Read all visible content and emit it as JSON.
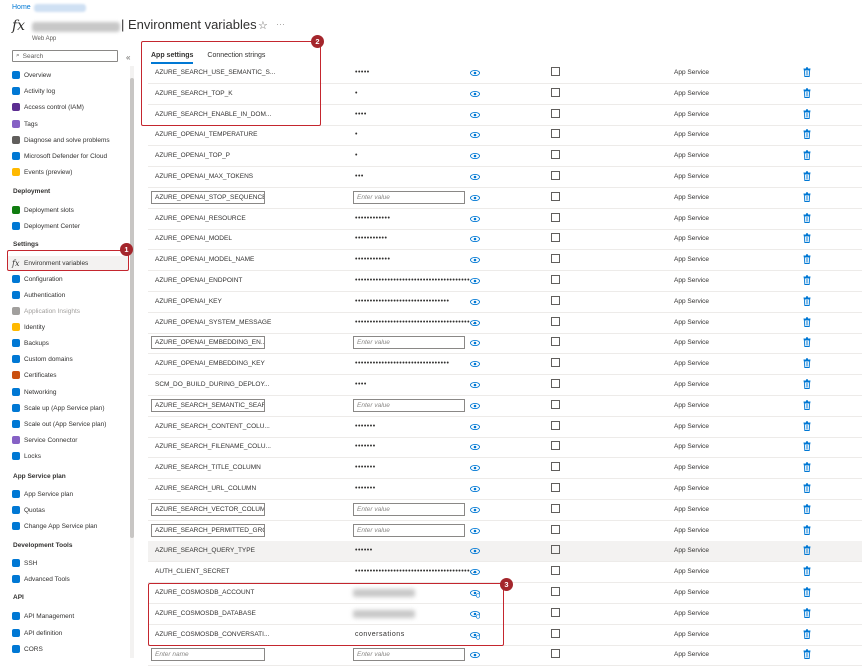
{
  "header": {
    "breadcrumb": "Home",
    "resource_type": "Web App",
    "title": "| Environment variables",
    "fx_glyph": "fx",
    "star": "☆",
    "more": "···"
  },
  "sidebar": {
    "search_placeholder": "Search",
    "collapse": "«",
    "items": [
      {
        "label": "Overview",
        "icon": "globe-icon",
        "color": "#0078d4"
      },
      {
        "label": "Activity log",
        "icon": "log-icon",
        "color": "#0078d4"
      },
      {
        "label": "Access control (IAM)",
        "icon": "people-icon",
        "color": "#5c2d91"
      },
      {
        "label": "Tags",
        "icon": "tag-icon",
        "color": "#8661c5"
      },
      {
        "label": "Diagnose and solve problems",
        "icon": "wrench-icon",
        "color": "#605e5c"
      },
      {
        "label": "Microsoft Defender for Cloud",
        "icon": "shield-icon",
        "color": "#0078d4"
      },
      {
        "label": "Events (preview)",
        "icon": "bolt-icon",
        "color": "#ffb900"
      }
    ],
    "sections": [
      {
        "title": "Deployment",
        "items": [
          {
            "label": "Deployment slots",
            "icon": "slots-icon",
            "color": "#107c10"
          },
          {
            "label": "Deployment Center",
            "icon": "cube-icon",
            "color": "#0078d4"
          }
        ]
      },
      {
        "title": "Settings",
        "items": [
          {
            "label": "Environment variables",
            "icon": "fx-icon",
            "color": "#323130"
          },
          {
            "label": "Configuration",
            "icon": "sliders-icon",
            "color": "#0078d4"
          },
          {
            "label": "Authentication",
            "icon": "person-key-icon",
            "color": "#0078d4"
          },
          {
            "label": "Application Insights",
            "icon": "lightbulb-icon",
            "color": "#a19f9d"
          },
          {
            "label": "Identity",
            "icon": "key-icon",
            "color": "#ffb900"
          },
          {
            "label": "Backups",
            "icon": "cloud-icon",
            "color": "#0078d4"
          },
          {
            "label": "Custom domains",
            "icon": "domain-icon",
            "color": "#0078d4"
          },
          {
            "label": "Certificates",
            "icon": "certificate-icon",
            "color": "#ca5010"
          },
          {
            "label": "Networking",
            "icon": "network-icon",
            "color": "#0078d4"
          },
          {
            "label": "Scale up (App Service plan)",
            "icon": "scale-up-icon",
            "color": "#0078d4"
          },
          {
            "label": "Scale out (App Service plan)",
            "icon": "scale-out-icon",
            "color": "#0078d4"
          },
          {
            "label": "Service Connector",
            "icon": "connector-icon",
            "color": "#8661c5"
          },
          {
            "label": "Locks",
            "icon": "lock-icon",
            "color": "#0078d4"
          }
        ]
      },
      {
        "title": "App Service plan",
        "items": [
          {
            "label": "App Service plan",
            "icon": "plan-icon",
            "color": "#0078d4"
          },
          {
            "label": "Quotas",
            "icon": "quota-icon",
            "color": "#0078d4"
          },
          {
            "label": "Change App Service plan",
            "icon": "change-plan-icon",
            "color": "#0078d4"
          }
        ]
      },
      {
        "title": "Development Tools",
        "items": [
          {
            "label": "SSH",
            "icon": "terminal-icon",
            "color": "#0078d4"
          },
          {
            "label": "Advanced Tools",
            "icon": "tools-icon",
            "color": "#0078d4"
          }
        ]
      },
      {
        "title": "API",
        "items": [
          {
            "label": "API Management",
            "icon": "api-cloud-icon",
            "color": "#0078d4"
          },
          {
            "label": "API definition",
            "icon": "api-def-icon",
            "color": "#0078d4"
          },
          {
            "label": "CORS",
            "icon": "cors-icon",
            "color": "#0078d4"
          }
        ]
      }
    ]
  },
  "tabs": [
    "App settings",
    "Connection strings"
  ],
  "settings": [
    {
      "name": "AZURE_SEARCH_USE_SEMANTIC_S...",
      "value": "•••••",
      "source": "App Service"
    },
    {
      "name": "AZURE_SEARCH_TOP_K",
      "value": "•",
      "source": "App Service"
    },
    {
      "name": "AZURE_SEARCH_ENABLE_IN_DOM...",
      "value": "••••",
      "source": "App Service"
    },
    {
      "name": "AZURE_OPENAI_TEMPERATURE",
      "value": "•",
      "source": "App Service"
    },
    {
      "name": "AZURE_OPENAI_TOP_P",
      "value": "•",
      "source": "App Service"
    },
    {
      "name": "AZURE_OPENAI_MAX_TOKENS",
      "value": "•••",
      "source": "App Service"
    },
    {
      "name": "AZURE_OPENAI_STOP_SEQUENCE",
      "value": "",
      "input": true,
      "placeholder": "Enter value",
      "source": "App Service"
    },
    {
      "name": "AZURE_OPENAI_RESOURCE",
      "value": "••••••••••••",
      "source": "App Service"
    },
    {
      "name": "AZURE_OPENAI_MODEL",
      "value": "•••••••••••",
      "source": "App Service"
    },
    {
      "name": "AZURE_OPENAI_MODEL_NAME",
      "value": "••••••••••••",
      "source": "App Service"
    },
    {
      "name": "AZURE_OPENAI_ENDPOINT",
      "value": "•••••••••••••••••••••••••••••••••••••••",
      "source": "App Service"
    },
    {
      "name": "AZURE_OPENAI_KEY",
      "value": "••••••••••••••••••••••••••••••••",
      "source": "App Service"
    },
    {
      "name": "AZURE_OPENAI_SYSTEM_MESSAGE",
      "value": "•••••••••••••••••••••••••••••••••••••••...",
      "source": "App Service"
    },
    {
      "name": "AZURE_OPENAI_EMBEDDING_EN...",
      "value": "",
      "input": true,
      "placeholder": "Enter value",
      "source": "App Service"
    },
    {
      "name": "AZURE_OPENAI_EMBEDDING_KEY",
      "value": "••••••••••••••••••••••••••••••••",
      "source": "App Service"
    },
    {
      "name": "SCM_DO_BUILD_DURING_DEPLOY...",
      "value": "••••",
      "source": "App Service"
    },
    {
      "name": "AZURE_SEARCH_SEMANTIC_SEAR...",
      "value": "",
      "input": true,
      "placeholder": "Enter value",
      "source": "App Service"
    },
    {
      "name": "AZURE_SEARCH_CONTENT_COLU...",
      "value": "•••••••",
      "source": "App Service"
    },
    {
      "name": "AZURE_SEARCH_FILENAME_COLU...",
      "value": "•••••••",
      "source": "App Service"
    },
    {
      "name": "AZURE_SEARCH_TITLE_COLUMN",
      "value": "•••••••",
      "source": "App Service"
    },
    {
      "name": "AZURE_SEARCH_URL_COLUMN",
      "value": "•••••••",
      "source": "App Service"
    },
    {
      "name": "AZURE_SEARCH_VECTOR_COLUM...",
      "value": "",
      "input": true,
      "placeholder": "Enter value",
      "source": "App Service"
    },
    {
      "name": "AZURE_SEARCH_PERMITTED_GRO...",
      "value": "",
      "input": true,
      "placeholder": "Enter value",
      "source": "App Service"
    },
    {
      "name": "AZURE_SEARCH_QUERY_TYPE",
      "value": "••••••",
      "source": "App Service",
      "highlight": true
    },
    {
      "name": "AUTH_CLIENT_SECRET",
      "value": "•••••••••••••••••••••••••••••••••••••••...",
      "source": "App Service"
    },
    {
      "name": "AZURE_COSMOSDB_ACCOUNT",
      "value": "",
      "blurred": true,
      "source": "App Service",
      "new": true
    },
    {
      "name": "AZURE_COSMOSDB_DATABASE",
      "value": "",
      "blurred": true,
      "source": "App Service",
      "new": true
    },
    {
      "name": "AZURE_COSMOSDB_CONVERSATI...",
      "value": "conversations",
      "source": "App Service",
      "new": true
    },
    {
      "name": "",
      "name_input": true,
      "name_placeholder": "Enter name",
      "value": "",
      "input": true,
      "placeholder": "Enter value",
      "source": "App Service"
    }
  ],
  "annotations": [
    "1",
    "2",
    "3"
  ],
  "colors": {
    "accent": "#0078d4",
    "annotation": "#a4262c"
  }
}
